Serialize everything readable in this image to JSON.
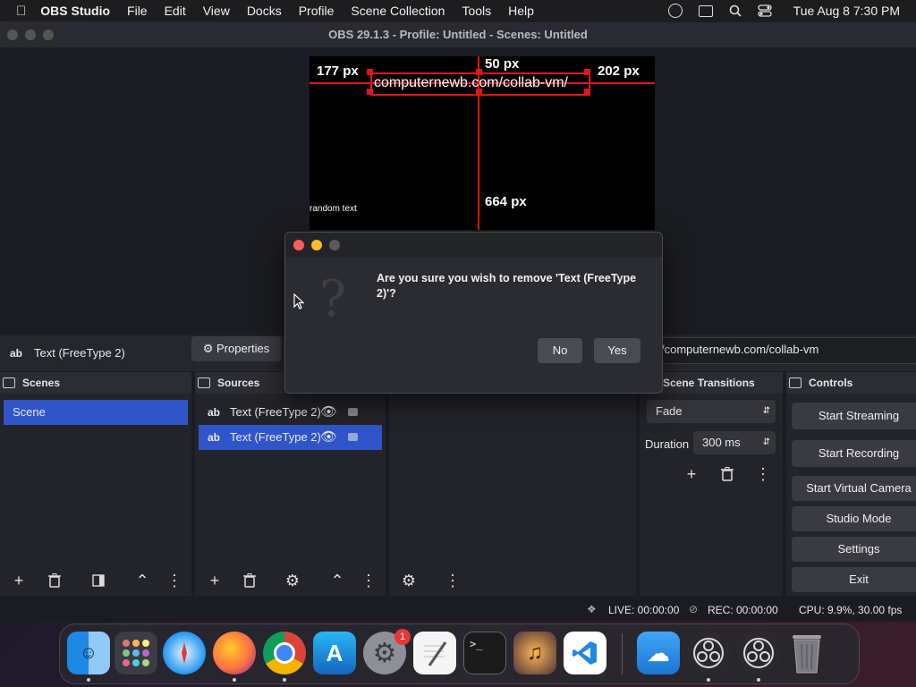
{
  "menubar": {
    "app": "OBS Studio",
    "items": [
      "File",
      "Edit",
      "View",
      "Docks",
      "Profile",
      "Scene Collection",
      "Tools",
      "Help"
    ],
    "clock": "Tue Aug 8  7:30 PM"
  },
  "window": {
    "title": "OBS 29.1.3 - Profile: Untitled - Scenes: Untitled"
  },
  "preview": {
    "left_px": "177 px",
    "top_px": "50 px",
    "right_px": "202 px",
    "bottom_px": "664 px",
    "selected_text": "computernewb.com/collab-vm/",
    "other_text": "random text"
  },
  "source_toolbar": {
    "source_name": "Text (FreeType 2)",
    "properties": "Properties",
    "text_value": "computernewb.com/collab-vm/"
  },
  "scenes": {
    "title": "Scenes",
    "items": [
      "Scene"
    ]
  },
  "sources": {
    "title": "Sources",
    "items": [
      "Text (FreeType 2)",
      "Text (FreeType 2)"
    ]
  },
  "transitions": {
    "title": "Scene Transitions",
    "selected": "Fade",
    "duration_label": "Duration",
    "duration_value": "300 ms"
  },
  "controls": {
    "title": "Controls",
    "start_streaming": "Start Streaming",
    "start_recording": "Start Recording",
    "start_virtual_camera": "Start Virtual Camera",
    "studio_mode": "Studio Mode",
    "settings": "Settings",
    "exit": "Exit"
  },
  "status": {
    "live": "LIVE: 00:00:00",
    "rec": "REC: 00:00:00",
    "cpu": "CPU: 9.9%, 30.00 fps"
  },
  "dialog": {
    "message": "Are you sure you wish to remove 'Text (FreeType 2)'?",
    "no": "No",
    "yes": "Yes"
  },
  "dock": {
    "badge": "1",
    "icons": [
      "finder-icon",
      "launchpad-icon",
      "safari-icon",
      "firefox-icon",
      "chrome-icon",
      "app-store-icon",
      "system-settings-icon",
      "textedit-icon",
      "terminal-icon",
      "garageband-icon",
      "vscode-icon",
      "weather-icon",
      "obs-icon",
      "obs-icon",
      "trash-icon"
    ]
  },
  "colors": {
    "accent": "#2f55c9",
    "guide": "#e01616"
  }
}
